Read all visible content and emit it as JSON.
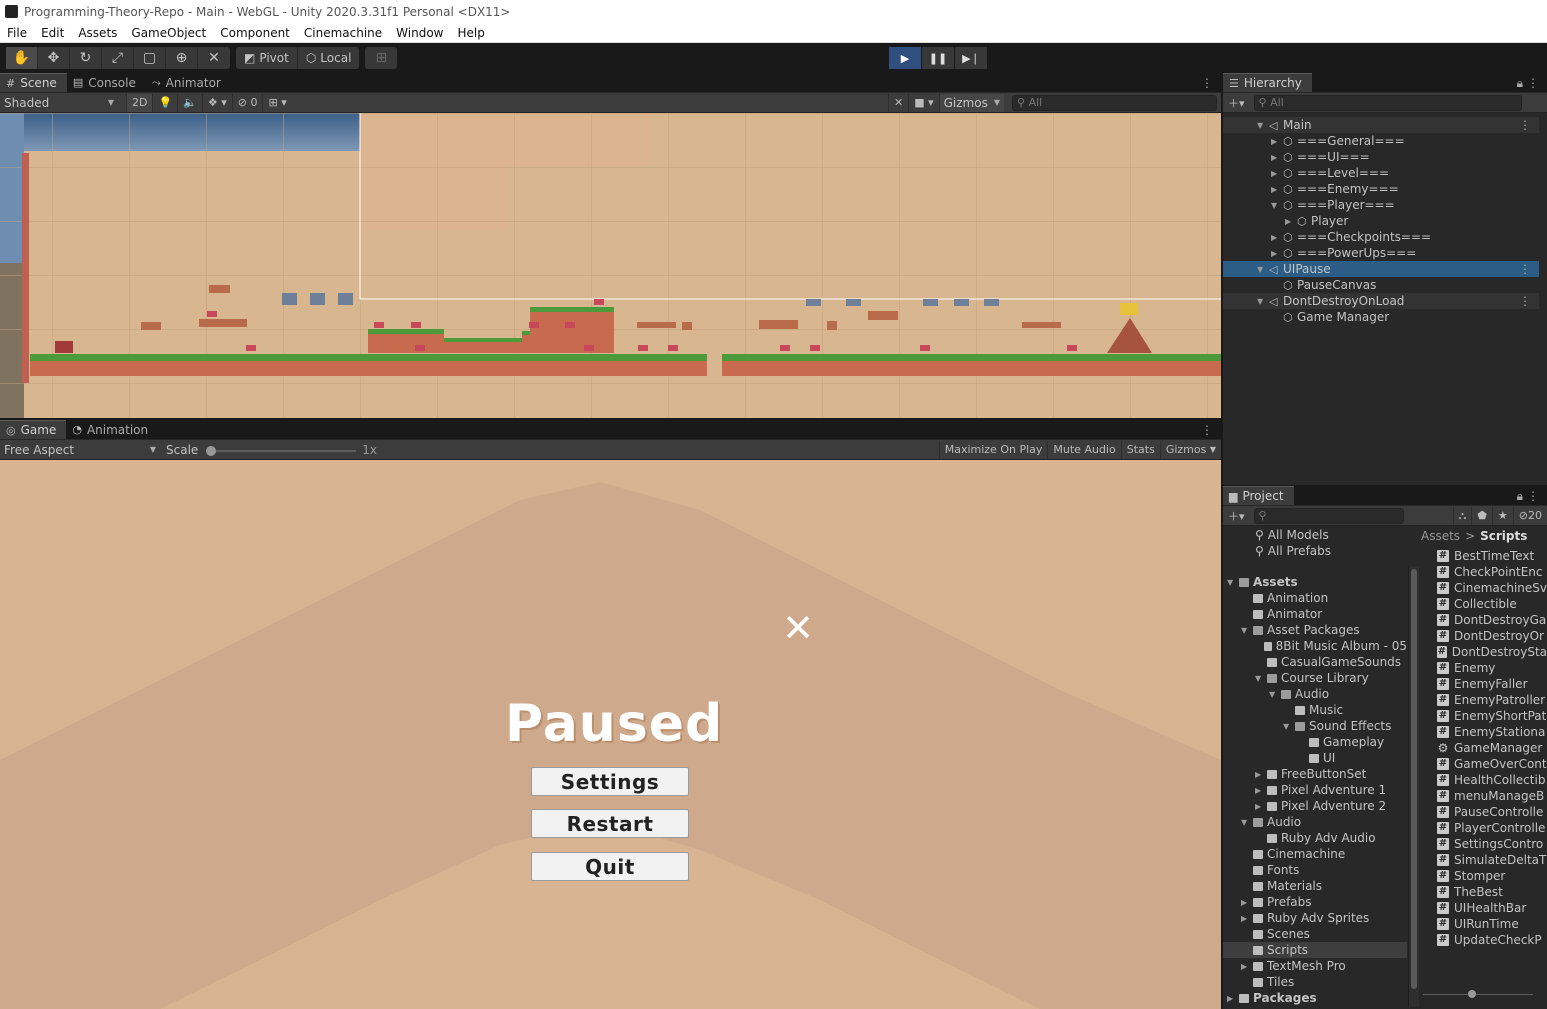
{
  "window": {
    "title": "Programming-Theory-Repo - Main - WebGL - Unity 2020.3.31f1 Personal <DX11>"
  },
  "menu": [
    "File",
    "Edit",
    "Assets",
    "GameObject",
    "Component",
    "Cinemachine",
    "Window",
    "Help"
  ],
  "toolbar": {
    "pivot_label": "Pivot",
    "local_label": "Local"
  },
  "scene_tabs": {
    "scene": "Scene",
    "console": "Console",
    "animator": "Animator"
  },
  "scene_bar": {
    "shading": "Shaded",
    "mode_2d": "2D",
    "hidden_count": "0",
    "gizmos": "Gizmos",
    "search_placeholder": "All"
  },
  "game_tabs": {
    "game": "Game",
    "animation": "Animation"
  },
  "game_bar": {
    "aspect": "Free Aspect",
    "scale_label": "Scale",
    "scale_value": "1x",
    "maximize": "Maximize On Play",
    "mute": "Mute Audio",
    "stats": "Stats",
    "gizmos": "Gizmos"
  },
  "game": {
    "title": "Paused",
    "close": "✕",
    "buttons": [
      "Settings",
      "Restart",
      "Quit"
    ]
  },
  "hierarchy": {
    "tab": "Hierarchy",
    "search_placeholder": "All",
    "items": [
      {
        "label": "Main",
        "depth": 0,
        "open": true,
        "scene": true
      },
      {
        "label": "===General===",
        "depth": 1
      },
      {
        "label": "===UI===",
        "depth": 1
      },
      {
        "label": "===Level===",
        "depth": 1
      },
      {
        "label": "===Enemy===",
        "depth": 1
      },
      {
        "label": "===Player===",
        "depth": 1,
        "open": true
      },
      {
        "label": "Player",
        "depth": 2
      },
      {
        "label": "===Checkpoints===",
        "depth": 1
      },
      {
        "label": "===PowerUps===",
        "depth": 1
      },
      {
        "label": "UIPause",
        "depth": 0,
        "open": true,
        "scene": true,
        "selected": true
      },
      {
        "label": "PauseCanvas",
        "depth": 1,
        "leaf": true
      },
      {
        "label": "DontDestroyOnLoad",
        "depth": 0,
        "open": true,
        "scene": true
      },
      {
        "label": "Game Manager",
        "depth": 1,
        "leaf": true
      }
    ]
  },
  "project": {
    "tab": "Project",
    "hidden_count": "20",
    "breadcrumb": [
      "Assets",
      "Scripts"
    ],
    "favorites": [
      "All Models",
      "All Prefabs"
    ],
    "tree": [
      {
        "label": "Assets",
        "depth": 0,
        "open": true,
        "bold": true
      },
      {
        "label": "Animation",
        "depth": 1
      },
      {
        "label": "Animator",
        "depth": 1
      },
      {
        "label": "Asset Packages",
        "depth": 1,
        "open": true
      },
      {
        "label": "8Bit Music Album - 05",
        "depth": 2
      },
      {
        "label": "CasualGameSounds",
        "depth": 2
      },
      {
        "label": "Course Library",
        "depth": 2,
        "open": true
      },
      {
        "label": "Audio",
        "depth": 3,
        "open": true
      },
      {
        "label": "Music",
        "depth": 4
      },
      {
        "label": "Sound Effects",
        "depth": 4,
        "open": true
      },
      {
        "label": "Gameplay",
        "depth": 5
      },
      {
        "label": "UI",
        "depth": 5
      },
      {
        "label": "FreeButtonSet",
        "depth": 2,
        "closed": true
      },
      {
        "label": "Pixel Adventure 1",
        "depth": 2,
        "closed": true
      },
      {
        "label": "Pixel Adventure 2",
        "depth": 2,
        "closed": true
      },
      {
        "label": "Audio",
        "depth": 1,
        "open": true
      },
      {
        "label": "Ruby Adv Audio",
        "depth": 2
      },
      {
        "label": "Cinemachine",
        "depth": 1
      },
      {
        "label": "Fonts",
        "depth": 1
      },
      {
        "label": "Materials",
        "depth": 1
      },
      {
        "label": "Prefabs",
        "depth": 1,
        "closed": true
      },
      {
        "label": "Ruby Adv Sprites",
        "depth": 1,
        "closed": true
      },
      {
        "label": "Scenes",
        "depth": 1
      },
      {
        "label": "Scripts",
        "depth": 1,
        "selected": true
      },
      {
        "label": "TextMesh Pro",
        "depth": 1,
        "closed": true
      },
      {
        "label": "Tiles",
        "depth": 1
      },
      {
        "label": "Packages",
        "depth": 0,
        "closed": true,
        "bold": true
      }
    ],
    "files": [
      {
        "name": "BestTimeText"
      },
      {
        "name": "CheckPointEnc"
      },
      {
        "name": "CinemachineSv"
      },
      {
        "name": "Collectible"
      },
      {
        "name": "DontDestroyGa"
      },
      {
        "name": "DontDestroyOr"
      },
      {
        "name": "DontDestroySta"
      },
      {
        "name": "Enemy"
      },
      {
        "name": "EnemyFaller"
      },
      {
        "name": "EnemyPatroller"
      },
      {
        "name": "EnemyShortPat"
      },
      {
        "name": "EnemyStationa"
      },
      {
        "name": "GameManager",
        "gear": true
      },
      {
        "name": "GameOverCont"
      },
      {
        "name": "HealthCollectib"
      },
      {
        "name": "menuManageB"
      },
      {
        "name": "PauseControlle"
      },
      {
        "name": "PlayerControlle"
      },
      {
        "name": "SettingsContro"
      },
      {
        "name": "SimulateDeltaT"
      },
      {
        "name": "Stomper"
      },
      {
        "name": "TheBest"
      },
      {
        "name": "UIHealthBar"
      },
      {
        "name": "UIRunTime"
      },
      {
        "name": "UpdateCheckP"
      }
    ]
  },
  "colors": {
    "editor_bg": "#383838",
    "panel_bg": "#282828",
    "selection": "#2c5d87",
    "play_active": "#2f4f7f",
    "game_bg": "#d8b492"
  }
}
